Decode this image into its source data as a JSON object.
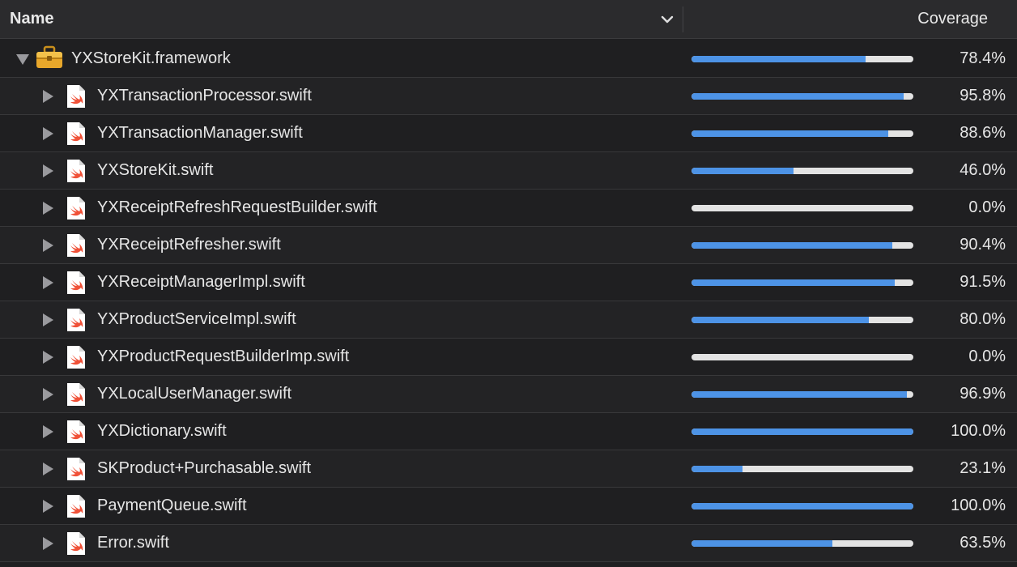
{
  "header": {
    "name_label": "Name",
    "coverage_label": "Coverage"
  },
  "colors": {
    "bar_fill": "#4d93e6",
    "bar_track": "#e3e3e3",
    "background": "#1f1f21"
  },
  "framework": {
    "name": "YXStoreKit.framework",
    "coverage": 78.4,
    "coverage_label": "78.4%",
    "expanded": true,
    "icon": "toolbox-icon"
  },
  "files": [
    {
      "name": "YXTransactionProcessor.swift",
      "coverage": 95.8,
      "coverage_label": "95.8%",
      "icon": "swift-file-icon"
    },
    {
      "name": "YXTransactionManager.swift",
      "coverage": 88.6,
      "coverage_label": "88.6%",
      "icon": "swift-file-icon"
    },
    {
      "name": "YXStoreKit.swift",
      "coverage": 46.0,
      "coverage_label": "46.0%",
      "icon": "swift-file-icon"
    },
    {
      "name": "YXReceiptRefreshRequestBuilder.swift",
      "coverage": 0.0,
      "coverage_label": "0.0%",
      "icon": "swift-file-icon"
    },
    {
      "name": "YXReceiptRefresher.swift",
      "coverage": 90.4,
      "coverage_label": "90.4%",
      "icon": "swift-file-icon"
    },
    {
      "name": "YXReceiptManagerImpl.swift",
      "coverage": 91.5,
      "coverage_label": "91.5%",
      "icon": "swift-file-icon"
    },
    {
      "name": "YXProductServiceImpl.swift",
      "coverage": 80.0,
      "coverage_label": "80.0%",
      "icon": "swift-file-icon"
    },
    {
      "name": "YXProductRequestBuilderImp.swift",
      "coverage": 0.0,
      "coverage_label": "0.0%",
      "icon": "swift-file-icon"
    },
    {
      "name": "YXLocalUserManager.swift",
      "coverage": 96.9,
      "coverage_label": "96.9%",
      "icon": "swift-file-icon"
    },
    {
      "name": "YXDictionary.swift",
      "coverage": 100.0,
      "coverage_label": "100.0%",
      "icon": "swift-file-icon"
    },
    {
      "name": "SKProduct+Purchasable.swift",
      "coverage": 23.1,
      "coverage_label": "23.1%",
      "icon": "swift-file-icon"
    },
    {
      "name": "PaymentQueue.swift",
      "coverage": 100.0,
      "coverage_label": "100.0%",
      "icon": "swift-file-icon"
    },
    {
      "name": "Error.swift",
      "coverage": 63.5,
      "coverage_label": "63.5%",
      "icon": "swift-file-icon"
    }
  ]
}
